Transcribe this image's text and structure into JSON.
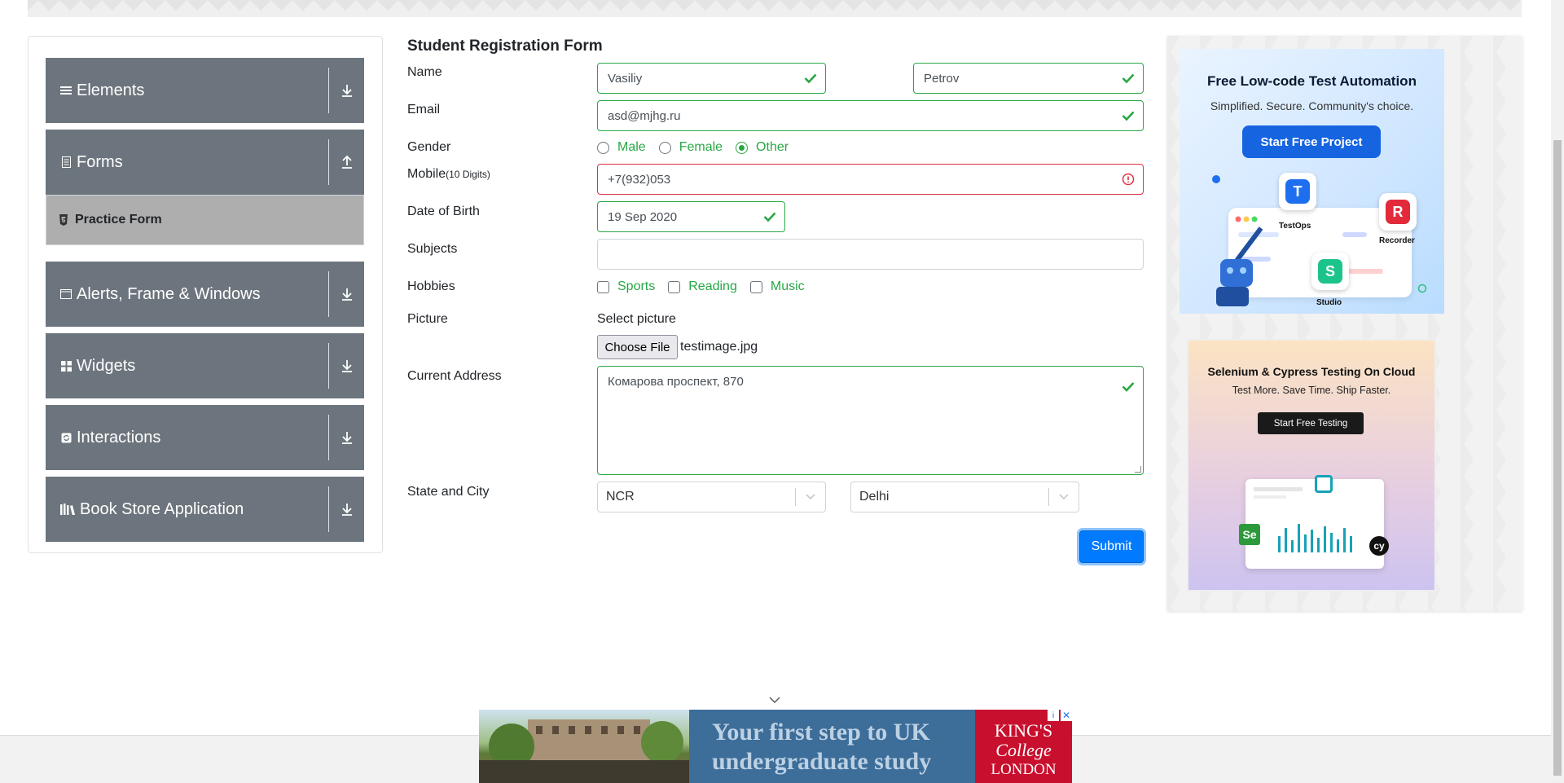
{
  "sidebar": {
    "groups": [
      {
        "label": "Elements",
        "icon": "hamburger-icon"
      },
      {
        "label": "Forms",
        "icon": "document-icon"
      },
      {
        "label": "Alerts, Frame & Windows",
        "icon": "window-icon"
      },
      {
        "label": "Widgets",
        "icon": "grid-icon"
      },
      {
        "label": "Interactions",
        "icon": "refresh-icon"
      },
      {
        "label": "Book Store Application",
        "icon": "books-icon"
      }
    ],
    "active_item": "Practice Form"
  },
  "form": {
    "title": "Student Registration Form",
    "name_label": "Name",
    "first_name": "Vasiliy",
    "last_name": "Petrov",
    "email_label": "Email",
    "email": "asd@mjhg.ru",
    "gender_label": "Gender",
    "gender_options": [
      "Male",
      "Female",
      "Other"
    ],
    "gender_selected": "Other",
    "mobile_label": "Mobile",
    "mobile_hint": "(10 Digits)",
    "mobile": "+7(932)053",
    "dob_label": "Date of Birth",
    "dob": "19 Sep 2020",
    "subjects_label": "Subjects",
    "subjects": "",
    "hobbies_label": "Hobbies",
    "hobbies": [
      "Sports",
      "Reading",
      "Music"
    ],
    "picture_label": "Picture",
    "select_picture": "Select picture",
    "choose_file": "Choose File",
    "file_name": "testimage.jpg",
    "address_label": "Current Address",
    "address": "Комарова проспект, 870",
    "state_city_label": "State and City",
    "state": "NCR",
    "city": "Delhi",
    "submit": "Submit"
  },
  "ads": {
    "ad1": {
      "title": "Free Low-code Test Automation",
      "subtitle": "Simplified. Secure. Community's choice.",
      "button": "Start Free Project",
      "tiles": [
        "TestOps",
        "Recorder",
        "Studio"
      ]
    },
    "ad2": {
      "title": "Selenium & Cypress Testing On Cloud",
      "subtitle": "Test More. Save Time. Ship Faster.",
      "button": "Start Free Testing"
    },
    "bottom": {
      "line1": "Your first step to UK",
      "line2": "undergraduate study",
      "logo1": "KING'S",
      "logo2": "College",
      "logo3": "LONDON"
    }
  },
  "colors": {
    "valid": "#28a745",
    "invalid": "#dc3545",
    "sidebar_group": "#6c757d",
    "primary": "#007bff"
  }
}
